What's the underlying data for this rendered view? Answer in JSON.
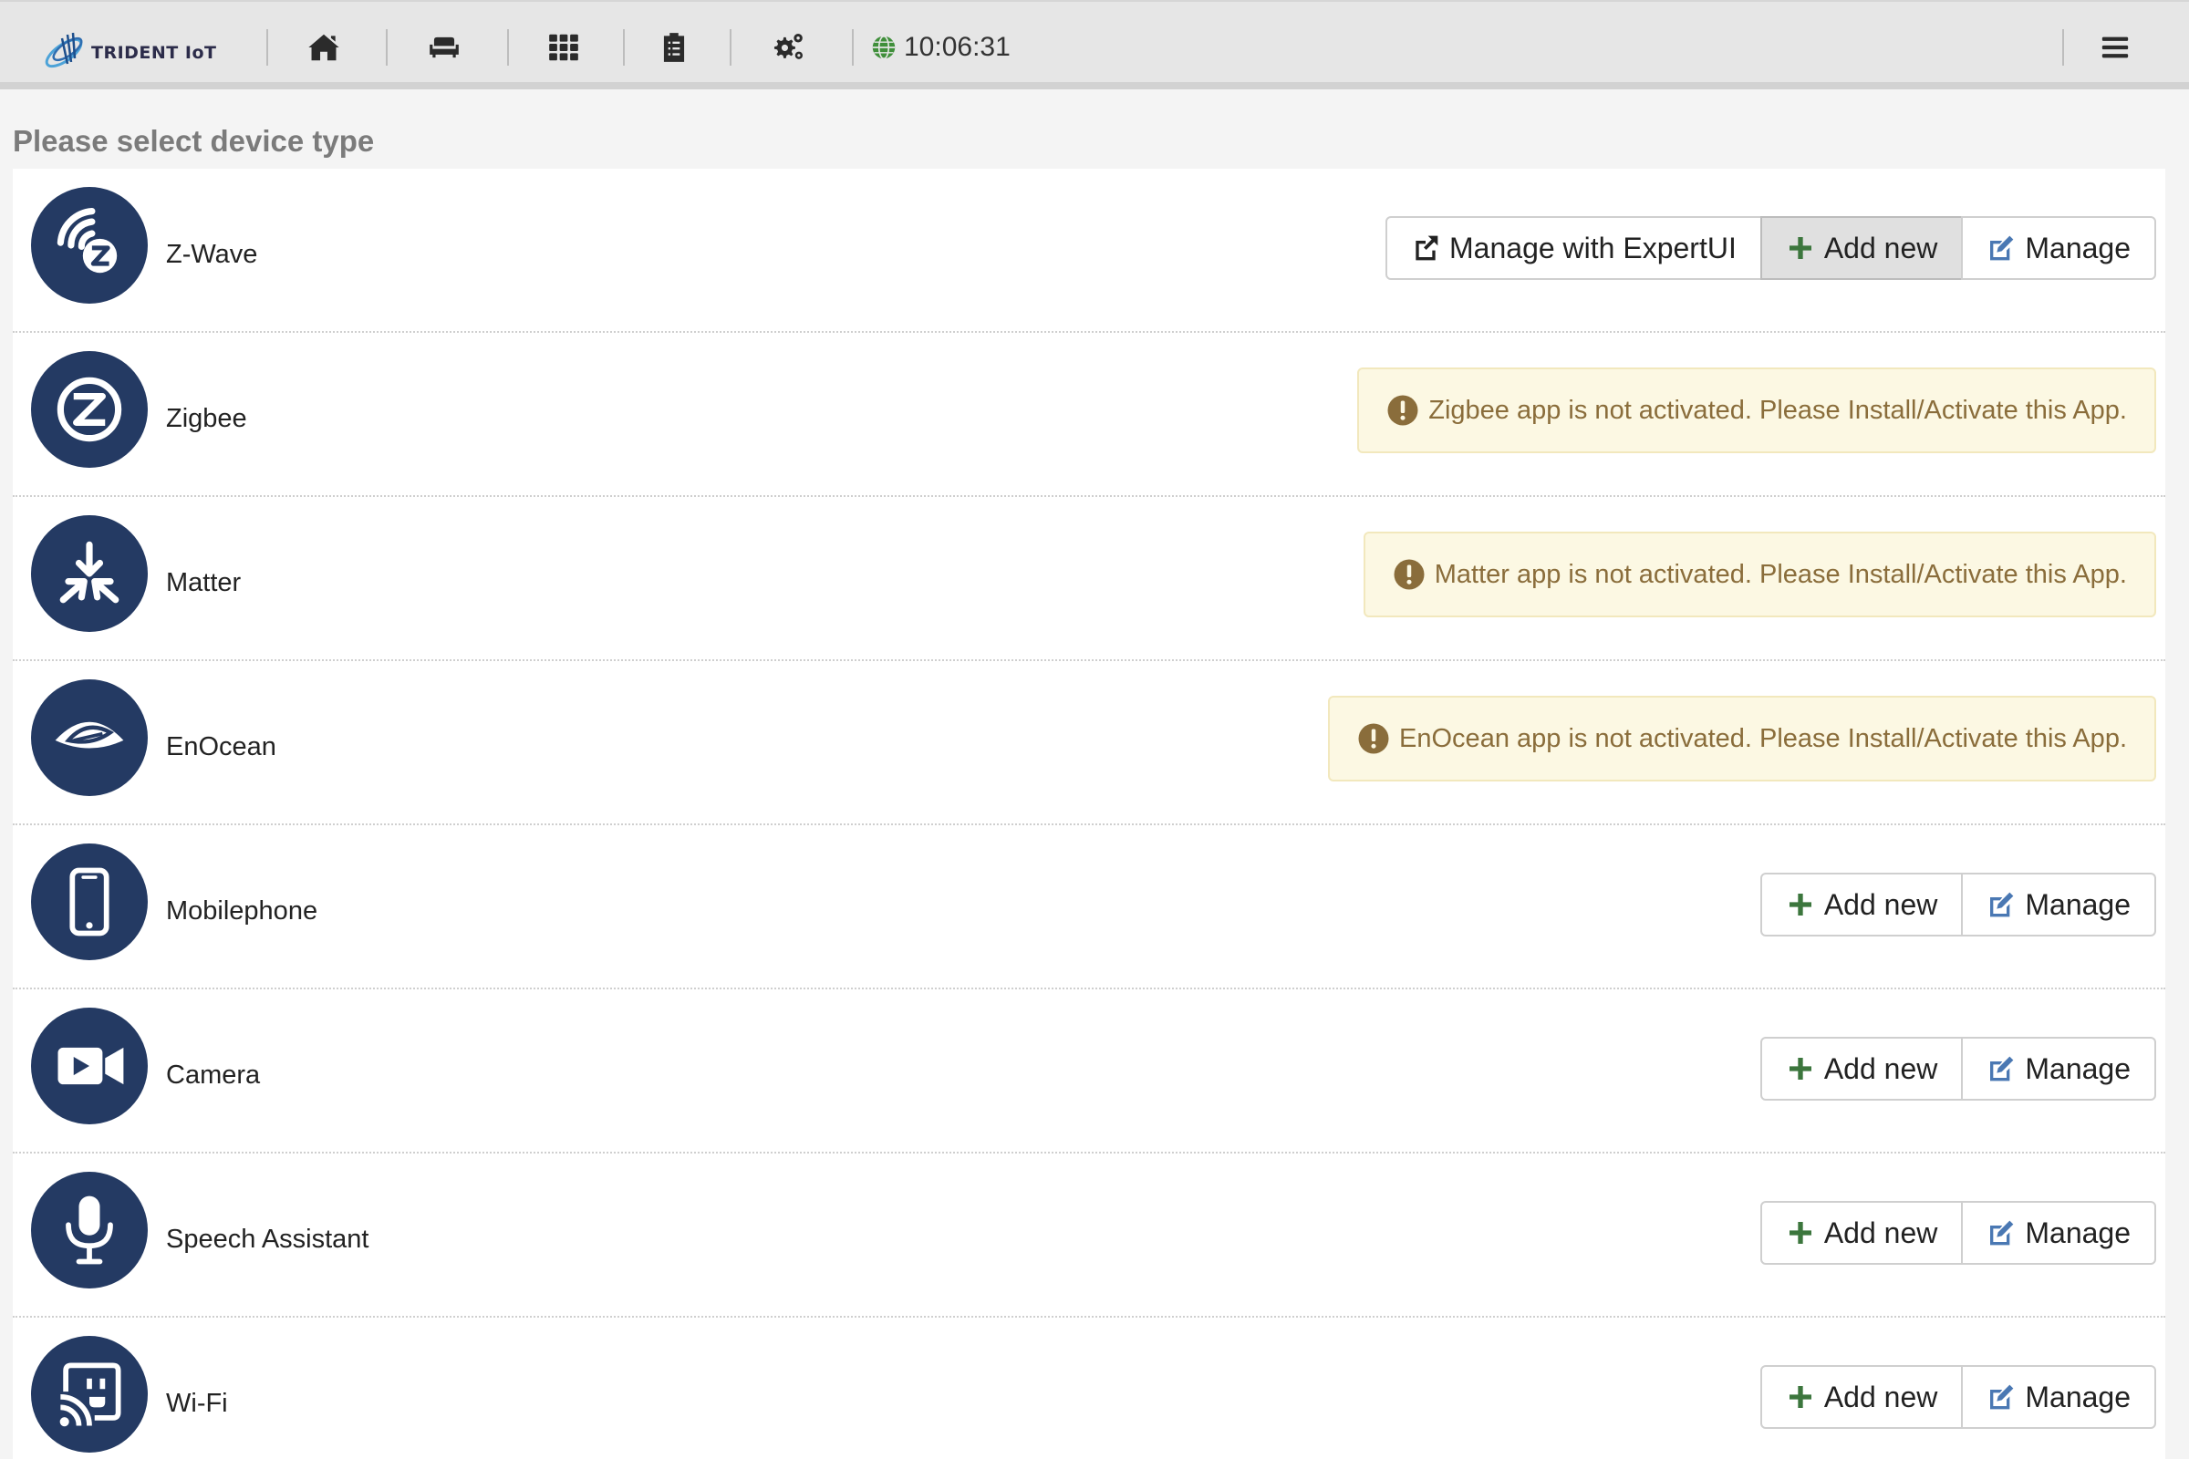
{
  "topbar": {
    "logo_text": "TRIDENT IoT",
    "clock": "10:06:31",
    "nav_icons": [
      "home-icon",
      "sofa-icon",
      "grid-icon",
      "clipboard-icon",
      "gears-icon"
    ],
    "menu_icon": "hamburger-icon"
  },
  "page": {
    "heading": "Please select device type"
  },
  "buttons": {
    "expert_label": "Manage with ExpertUI",
    "add_label": "Add new",
    "manage_label": "Manage"
  },
  "devices": [
    {
      "label": "Z-Wave",
      "icon": "zwave-icon"
    },
    {
      "label": "Zigbee",
      "icon": "zigbee-icon",
      "alert": "Zigbee app is not activated. Please Install/Activate this App."
    },
    {
      "label": "Matter",
      "icon": "matter-icon",
      "alert": "Matter app is not activated. Please Install/Activate this App."
    },
    {
      "label": "EnOcean",
      "icon": "enocean-icon",
      "alert": "EnOcean app is not activated. Please Install/Activate this App."
    },
    {
      "label": "Mobilephone",
      "icon": "mobilephone-icon"
    },
    {
      "label": "Camera",
      "icon": "camera-icon"
    },
    {
      "label": "Speech Assistant",
      "icon": "microphone-icon"
    },
    {
      "label": "Wi-Fi",
      "icon": "wifi-icon"
    }
  ],
  "colors": {
    "icon_circle": "#243a63",
    "plus_green": "#3c763d",
    "edit_blue": "#4a78b3",
    "alert_bg": "#fcf8e3",
    "alert_text": "#8a6d3b"
  }
}
